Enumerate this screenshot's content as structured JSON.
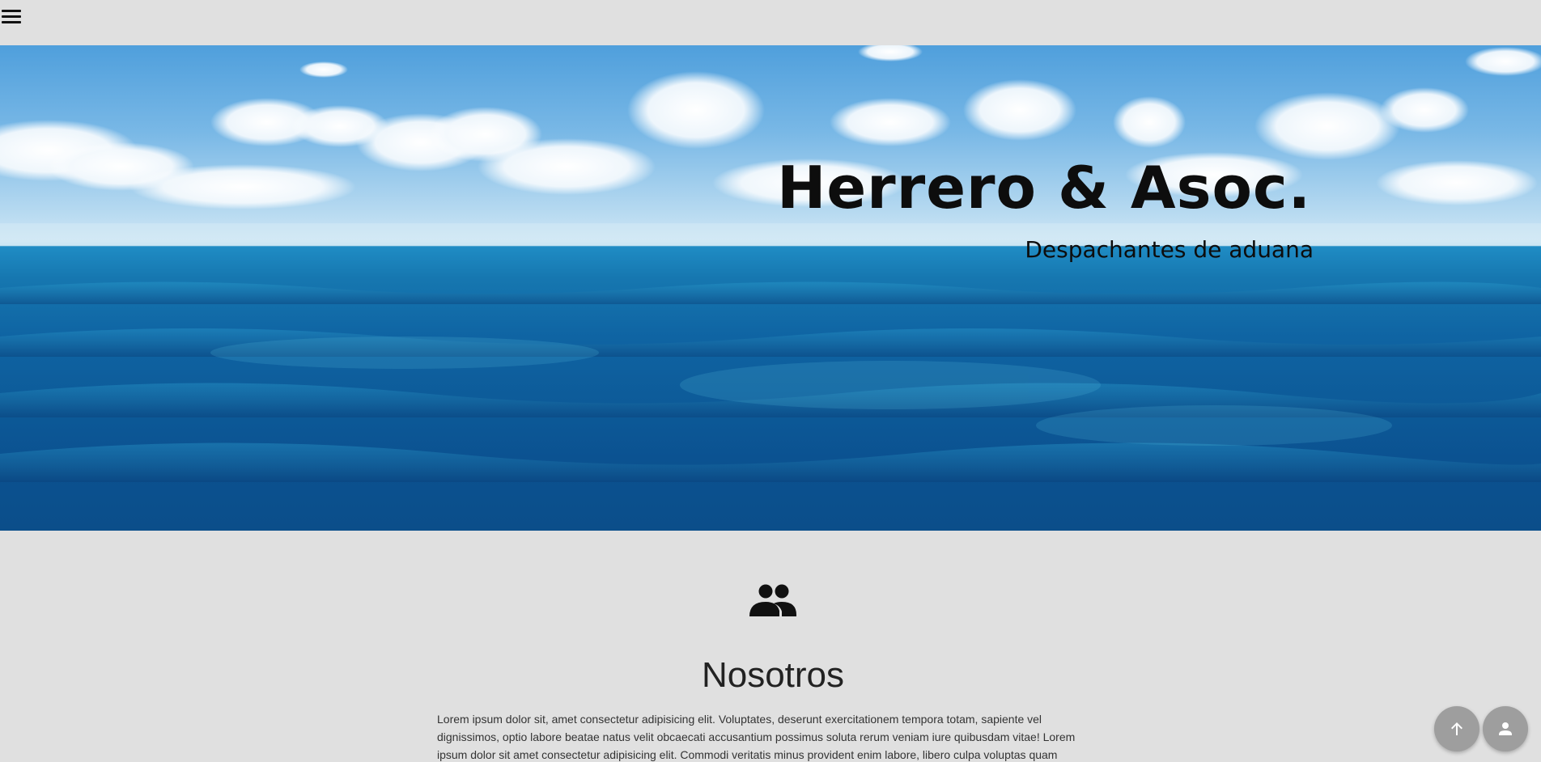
{
  "header": {
    "menu_icon": "hamburger-menu-icon"
  },
  "hero": {
    "title": "Herrero & Asoc.",
    "subtitle": "Despachantes de aduana",
    "background": "ocean-horizon-with-clouds"
  },
  "about": {
    "icon": "people-icon",
    "title": "Nosotros",
    "body": "Lorem ipsum dolor sit, amet consectetur adipisicing elit. Voluptates, deserunt exercitationem tempora totam, sapiente vel dignissimos, optio labore beatae natus velit obcaecati accusantium possimus soluta rerum veniam iure quibusdam vitae! Lorem ipsum dolor sit amet consectetur adipisicing elit. Commodi veritatis minus provident enim labore, libero culpa voluptas quam"
  },
  "fabs": {
    "scroll_top_icon": "arrow-up-icon",
    "user_icon": "person-icon"
  },
  "colors": {
    "page_bg": "#e0e0e0",
    "fab_bg": "#9e9e9e",
    "text": "#0d0d0d"
  }
}
